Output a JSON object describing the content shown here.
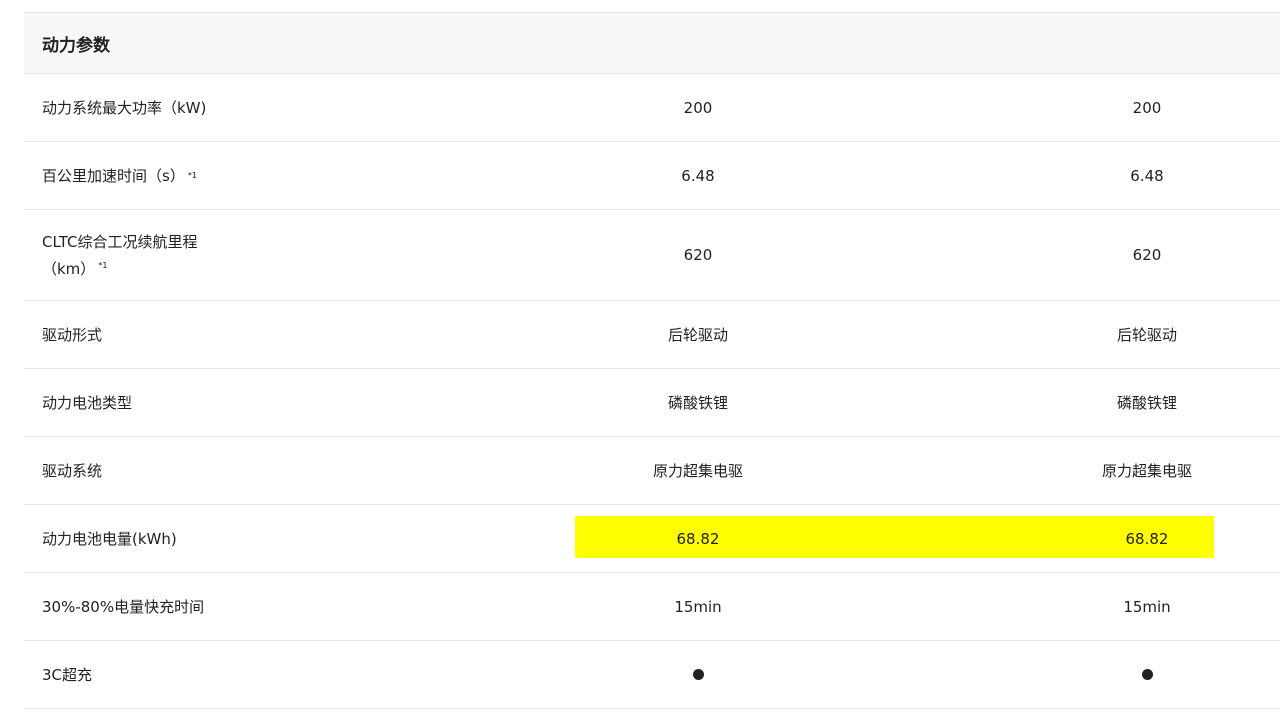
{
  "section": {
    "title": "动力参数"
  },
  "rows": [
    {
      "label": "动力系统最大功率（kW)",
      "sup": "",
      "v1": "200",
      "v2": "200"
    },
    {
      "label": "百公里加速时间（s）",
      "sup": "*1",
      "v1": "6.48",
      "v2": "6.48"
    },
    {
      "label": "CLTC综合工况续航里程（km）",
      "sup": "*1",
      "v1": "620",
      "v2": "620"
    },
    {
      "label": "驱动形式",
      "sup": "",
      "v1": "后轮驱动",
      "v2": "后轮驱动"
    },
    {
      "label": "动力电池类型",
      "sup": "",
      "v1": "磷酸铁锂",
      "v2": "磷酸铁锂"
    },
    {
      "label": "驱动系统",
      "sup": "",
      "v1": "原力超集电驱",
      "v2": "原力超集电驱"
    },
    {
      "label": "动力电池电量(kWh)",
      "sup": "",
      "v1": "68.82",
      "v2": "68.82",
      "highlighted": true
    },
    {
      "label": "30%-80%电量快充时间",
      "sup": "",
      "v1": "15min",
      "v2": "15min"
    },
    {
      "label": "3C超充",
      "sup": "",
      "v1": "dot-icon",
      "v2": "dot-icon"
    }
  ],
  "colors": {
    "highlight": "#ffff00",
    "header_bg": "#f7f7f7",
    "divider": "#e6e6e6"
  }
}
